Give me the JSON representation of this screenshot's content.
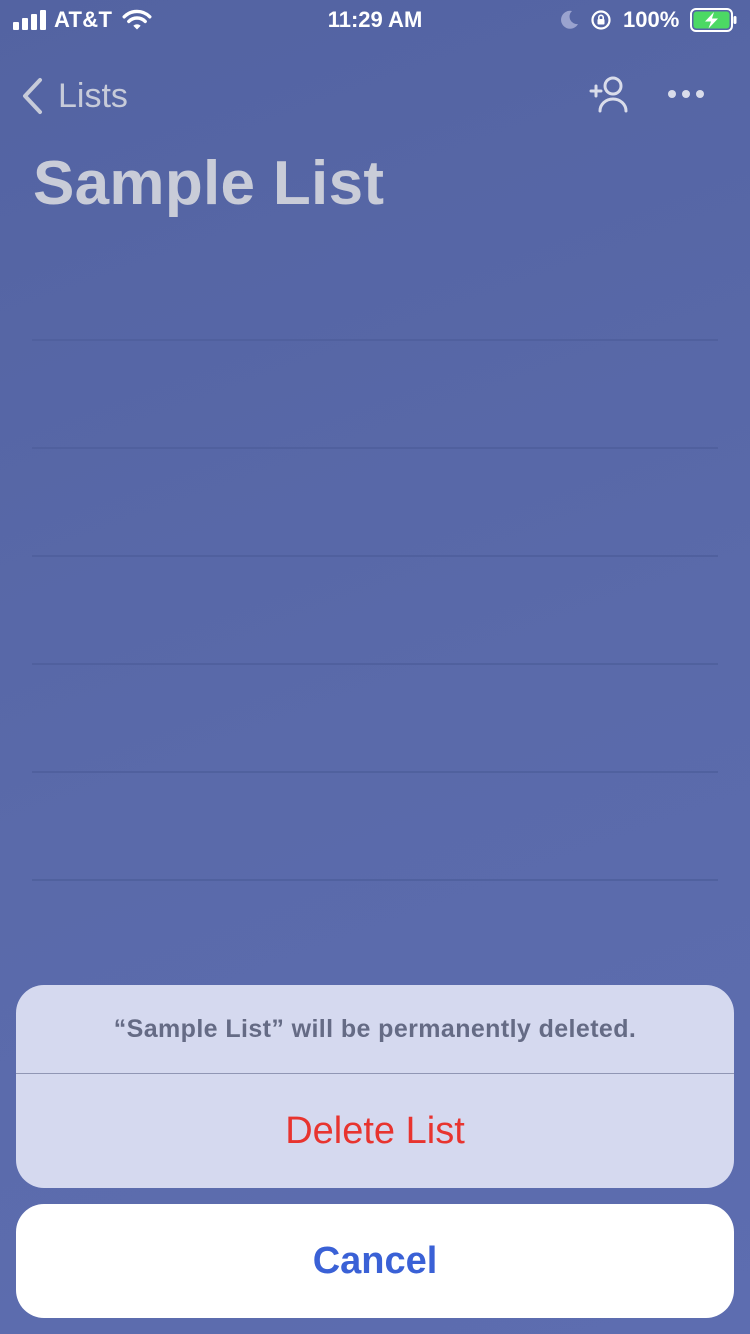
{
  "status_bar": {
    "carrier": "AT&T",
    "time": "11:29 AM",
    "battery_percent": "100%",
    "signal_bars": 4,
    "battery_level": 1.0,
    "charging": true,
    "battery_color": "#4cd964"
  },
  "nav": {
    "back_label": "Lists",
    "back_icon": "chevron-left-icon",
    "add_person_icon": "add-person-icon",
    "more_icon": "more-icon"
  },
  "page": {
    "title": "Sample List"
  },
  "list": {
    "rows": 6
  },
  "action_sheet": {
    "message": "“Sample List” will be permanently deleted.",
    "delete_label": "Delete List",
    "cancel_label": "Cancel",
    "destructive_color": "#e8342f",
    "cancel_color": "#3a61d6"
  },
  "colors": {
    "background": "#5667a6",
    "sheet_background": "#d5d9ef"
  }
}
